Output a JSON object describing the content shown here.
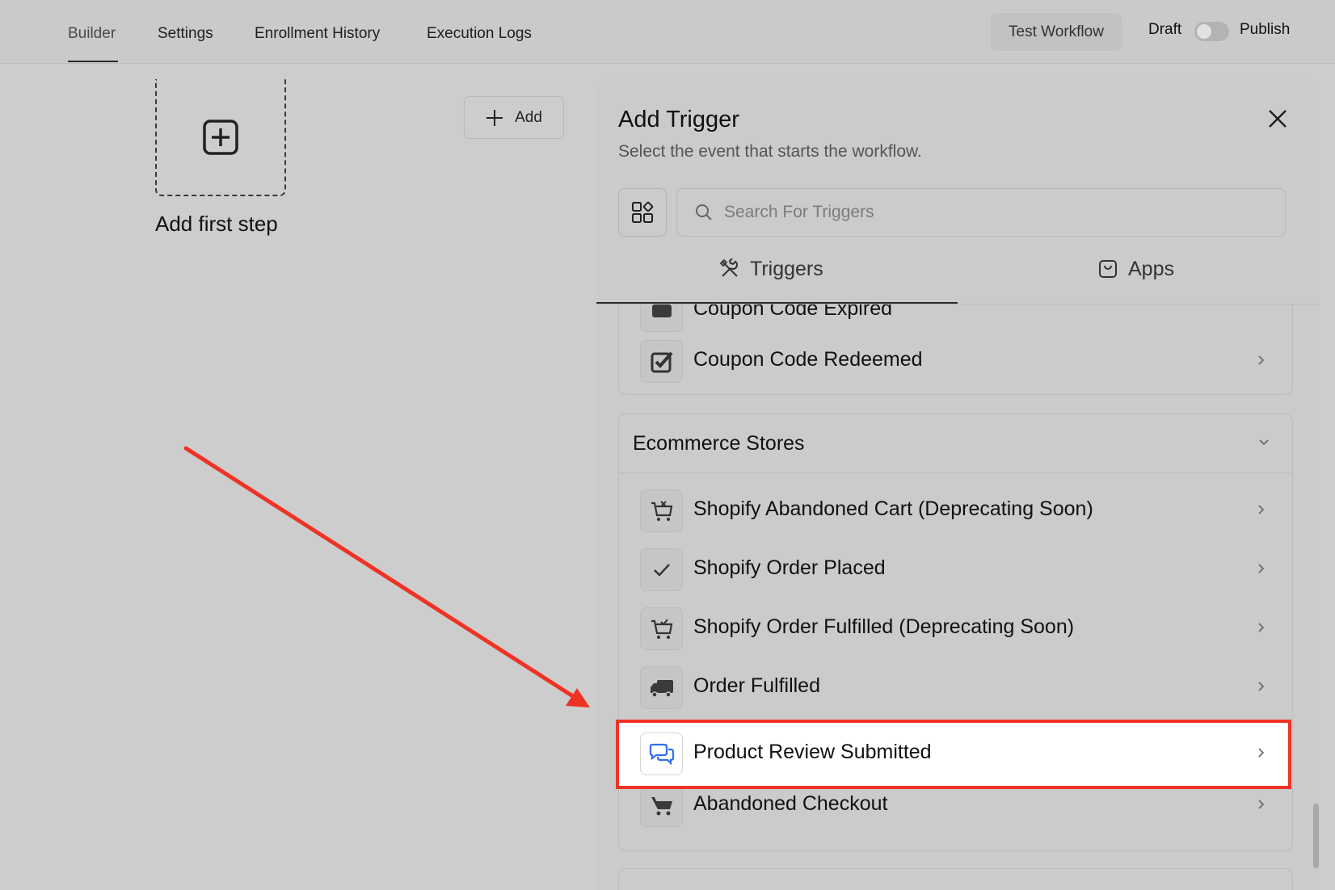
{
  "nav": {
    "tabs": [
      "Builder",
      "Settings",
      "Enrollment History",
      "Execution Logs"
    ],
    "test_workflow": "Test Workflow",
    "draft": "Draft",
    "publish": "Publish"
  },
  "canvas": {
    "add_first_step": "Add first step",
    "add_button": "Add"
  },
  "panel": {
    "title": "Add Trigger",
    "subtitle": "Select the event that starts the workflow.",
    "search_placeholder": "Search For Triggers",
    "tabs": [
      "Triggers",
      "Apps"
    ],
    "partial_item": "Coupon Code Expired",
    "coupon_redeemed": "Coupon Code Redeemed",
    "section_title": "Ecommerce Stores",
    "items": [
      "Shopify Abandoned Cart (Deprecating Soon)",
      "Shopify Order Placed",
      "Shopify Order Fulfilled (Deprecating Soon)",
      "Order Fulfilled",
      "Product Review Submitted",
      "Abandoned Checkout"
    ]
  },
  "colors": {
    "highlight": "#ee3326",
    "review_icon": "#2f6ee8",
    "arrow": "#ee3326"
  }
}
